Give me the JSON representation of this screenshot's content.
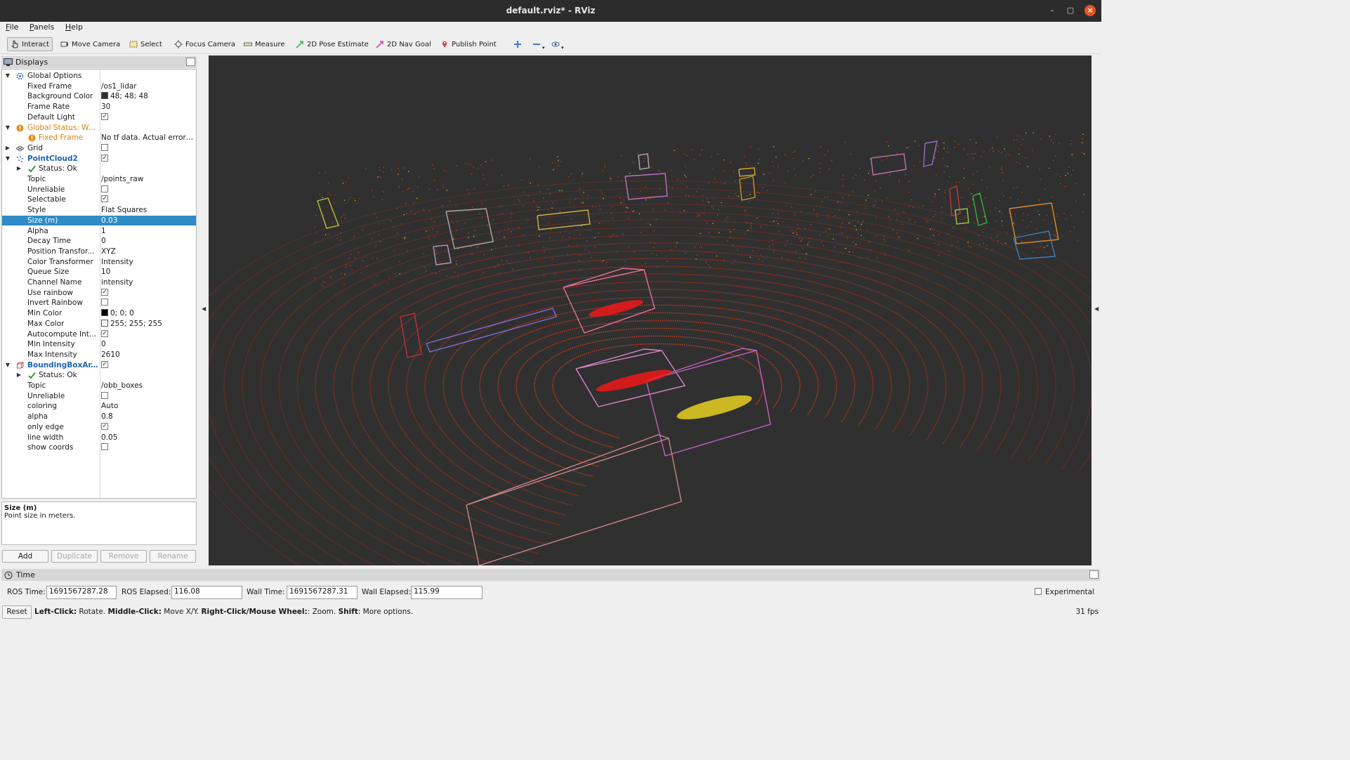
{
  "window": {
    "title": "default.rviz* - RViz"
  },
  "menu": [
    "File",
    "Panels",
    "Help"
  ],
  "toolbar": {
    "tools": [
      "Interact",
      "Move Camera",
      "Select",
      "Focus Camera",
      "Measure",
      "2D Pose Estimate",
      "2D Nav Goal",
      "Publish Point"
    ],
    "active": "Interact",
    "colors": {
      "pose": "#3fbf3f",
      "nav": "#d63fd6",
      "point": "#d04040",
      "plus": "#3a7bd5"
    }
  },
  "displays": {
    "title": "Displays",
    "rows": [
      {
        "name": "Global Options",
        "value": "",
        "arrow": "▼",
        "indent": 0,
        "style": "",
        "icon": "gear-icon"
      },
      {
        "name": "Fixed Frame",
        "value": "/os1_lidar",
        "indent": 1
      },
      {
        "name": "Background Color",
        "value": "48; 48; 48",
        "indent": 1,
        "swatch": "#303030"
      },
      {
        "name": "Frame Rate",
        "value": "30",
        "indent": 1
      },
      {
        "name": "Default Light",
        "value": "",
        "indent": 1,
        "check": true
      },
      {
        "name": "Global Status: Warn",
        "value": "",
        "arrow": "▼",
        "indent": 0,
        "style": "warn",
        "icon": "warning-icon"
      },
      {
        "name": "Fixed Frame",
        "value": "No tf data.  Actual error: ...",
        "indent": 1,
        "style": "warn",
        "icon": "warning-icon"
      },
      {
        "name": "Grid",
        "value": "",
        "arrow": "▶",
        "indent": 0,
        "check": false,
        "icon": "grid-icon"
      },
      {
        "name": "PointCloud2",
        "value": "",
        "arrow": "▼",
        "indent": 0,
        "style": "blue",
        "check": true,
        "icon": "pointcloud-icon"
      },
      {
        "name": "Status: Ok",
        "value": "",
        "arrow": "▶",
        "indent": 1,
        "icon": "checkmark-icon"
      },
      {
        "name": "Topic",
        "value": "/points_raw",
        "indent": 1
      },
      {
        "name": "Unreliable",
        "value": "",
        "indent": 1,
        "check": false
      },
      {
        "name": "Selectable",
        "value": "",
        "indent": 1,
        "check": true
      },
      {
        "name": "Style",
        "value": "Flat Squares",
        "indent": 1
      },
      {
        "name": "Size (m)",
        "value": "0.03",
        "indent": 1,
        "selected": true
      },
      {
        "name": "Alpha",
        "value": "1",
        "indent": 1
      },
      {
        "name": "Decay Time",
        "value": "0",
        "indent": 1
      },
      {
        "name": "Position Transfor...",
        "value": "XYZ",
        "indent": 1
      },
      {
        "name": "Color Transformer",
        "value": "Intensity",
        "indent": 1
      },
      {
        "name": "Queue Size",
        "value": "10",
        "indent": 1
      },
      {
        "name": "Channel Name",
        "value": "intensity",
        "indent": 1
      },
      {
        "name": "Use rainbow",
        "value": "",
        "indent": 1,
        "check": true
      },
      {
        "name": "Invert Rainbow",
        "value": "",
        "indent": 1,
        "check": false
      },
      {
        "name": "Min Color",
        "value": "0; 0; 0",
        "indent": 1,
        "swatch": "#000000"
      },
      {
        "name": "Max Color",
        "value": "255; 255; 255",
        "indent": 1,
        "swatch": "#ffffff"
      },
      {
        "name": "Autocompute Inte...",
        "value": "",
        "indent": 1,
        "check": true
      },
      {
        "name": "Min Intensity",
        "value": "0",
        "indent": 1
      },
      {
        "name": "Max Intensity",
        "value": "2610",
        "indent": 1
      },
      {
        "name": "BoundingBoxAr...",
        "value": "",
        "arrow": "▼",
        "indent": 0,
        "style": "blue",
        "check": true,
        "icon": "bbox-icon"
      },
      {
        "name": "Status: Ok",
        "value": "",
        "arrow": "▶",
        "indent": 1,
        "icon": "checkmark-icon"
      },
      {
        "name": "Topic",
        "value": "/obb_boxes",
        "indent": 1
      },
      {
        "name": "Unreliable",
        "value": "",
        "indent": 1,
        "check": false
      },
      {
        "name": "coloring",
        "value": "Auto",
        "indent": 1
      },
      {
        "name": "alpha",
        "value": "0.8",
        "indent": 1
      },
      {
        "name": "only edge",
        "value": "",
        "indent": 1,
        "check": true
      },
      {
        "name": "line width",
        "value": "0.05",
        "indent": 1
      },
      {
        "name": "show coords",
        "value": "",
        "indent": 1,
        "check": false
      }
    ],
    "description": {
      "title": "Size (m)",
      "text": "Point size in meters."
    },
    "buttons": {
      "add": "Add",
      "duplicate": "Duplicate",
      "remove": "Remove",
      "rename": "Rename"
    }
  },
  "time": {
    "title": "Time",
    "ros_time_label": "ROS Time:",
    "ros_time": "1691567287.28",
    "ros_elapsed_label": "ROS Elapsed:",
    "ros_elapsed": "116.08",
    "wall_time_label": "Wall Time:",
    "wall_time": "1691567287.31",
    "wall_elapsed_label": "Wall Elapsed:",
    "wall_elapsed": "115.99",
    "experimental": "Experimental"
  },
  "status": {
    "reset": "Reset",
    "hint_parts": [
      {
        "b": "Left-Click:",
        "t": " Rotate. "
      },
      {
        "b": "Middle-Click:",
        "t": " Move X/Y. "
      },
      {
        "b": "Right-Click/Mouse Wheel:",
        "t": ": Zoom. "
      },
      {
        "b": "Shift",
        "t": ": More options."
      }
    ],
    "fps": "31 fps"
  }
}
